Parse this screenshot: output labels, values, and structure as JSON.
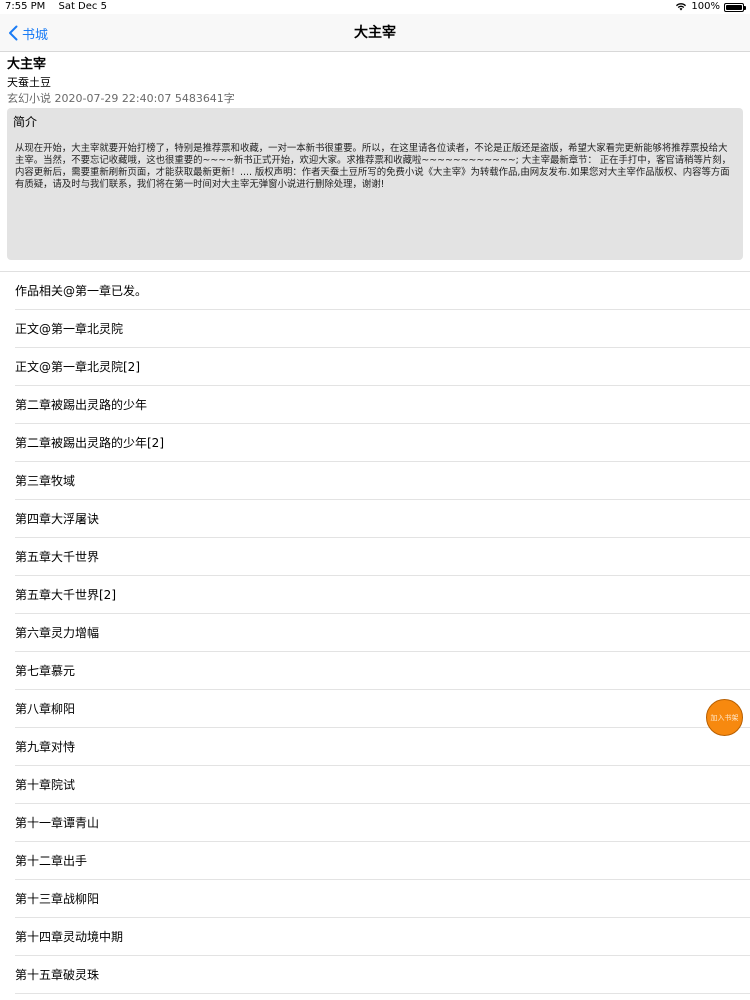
{
  "status_bar": {
    "time": "7:55 PM",
    "date": "Sat Dec 5",
    "battery": "100%",
    "battery_level": 1.0,
    "icons": [
      "wifi-icon",
      "battery-icon"
    ]
  },
  "nav": {
    "back_label": "书城",
    "title": "大主宰",
    "accent_color": "#1a7cf5"
  },
  "book": {
    "title": "大主宰",
    "author": "天蚕土豆",
    "meta": "玄幻小说 2020-07-29 22:40:07 5483641字"
  },
  "intro": {
    "heading": "简介",
    "text": "从现在开始，大主宰就要开始打榜了，特别是推荐票和收藏，一对一本新书很重要。所以，在这里请各位读者，不论是正版还是盗版，希望大家看完更新能够将推荐票投给大主宰。当然，不要忘记收藏哦，这也很重要的~~~~新书正式开始，欢迎大家。求推荐票和收藏啦~~~~~~~~~~~~; 大主宰最新章节： 正在手打中，客官请稍等片刻，内容更新后，需要重新刷新页面，才能获取最新更新！.... 版权声明：作者天蚕土豆所写的免费小说《大主宰》为转载作品,由网友发布.如果您对大主宰作品版权、内容等方面有质疑，请及时与我们联系，我们将在第一时间对大主宰无弹窗小说进行删除处理，谢谢!"
  },
  "chapters": [
    "作品相关@第一章已发。",
    "正文@第一章北灵院",
    "正文@第一章北灵院[2]",
    "第二章被踢出灵路的少年",
    "第二章被踢出灵路的少年[2]",
    "第三章牧域",
    "第四章大浮屠诀",
    "第五章大千世界",
    "第五章大千世界[2]",
    "第六章灵力增幅",
    "第七章慕元",
    "第八章柳阳",
    "第九章对恃",
    "第十章院试",
    "第十一章谭青山",
    "第十二章出手",
    "第十三章战柳阳",
    "第十四章灵动境中期",
    "第十五章破灵珠"
  ],
  "fab": {
    "label": "加入书架",
    "color": "#f7890f"
  }
}
